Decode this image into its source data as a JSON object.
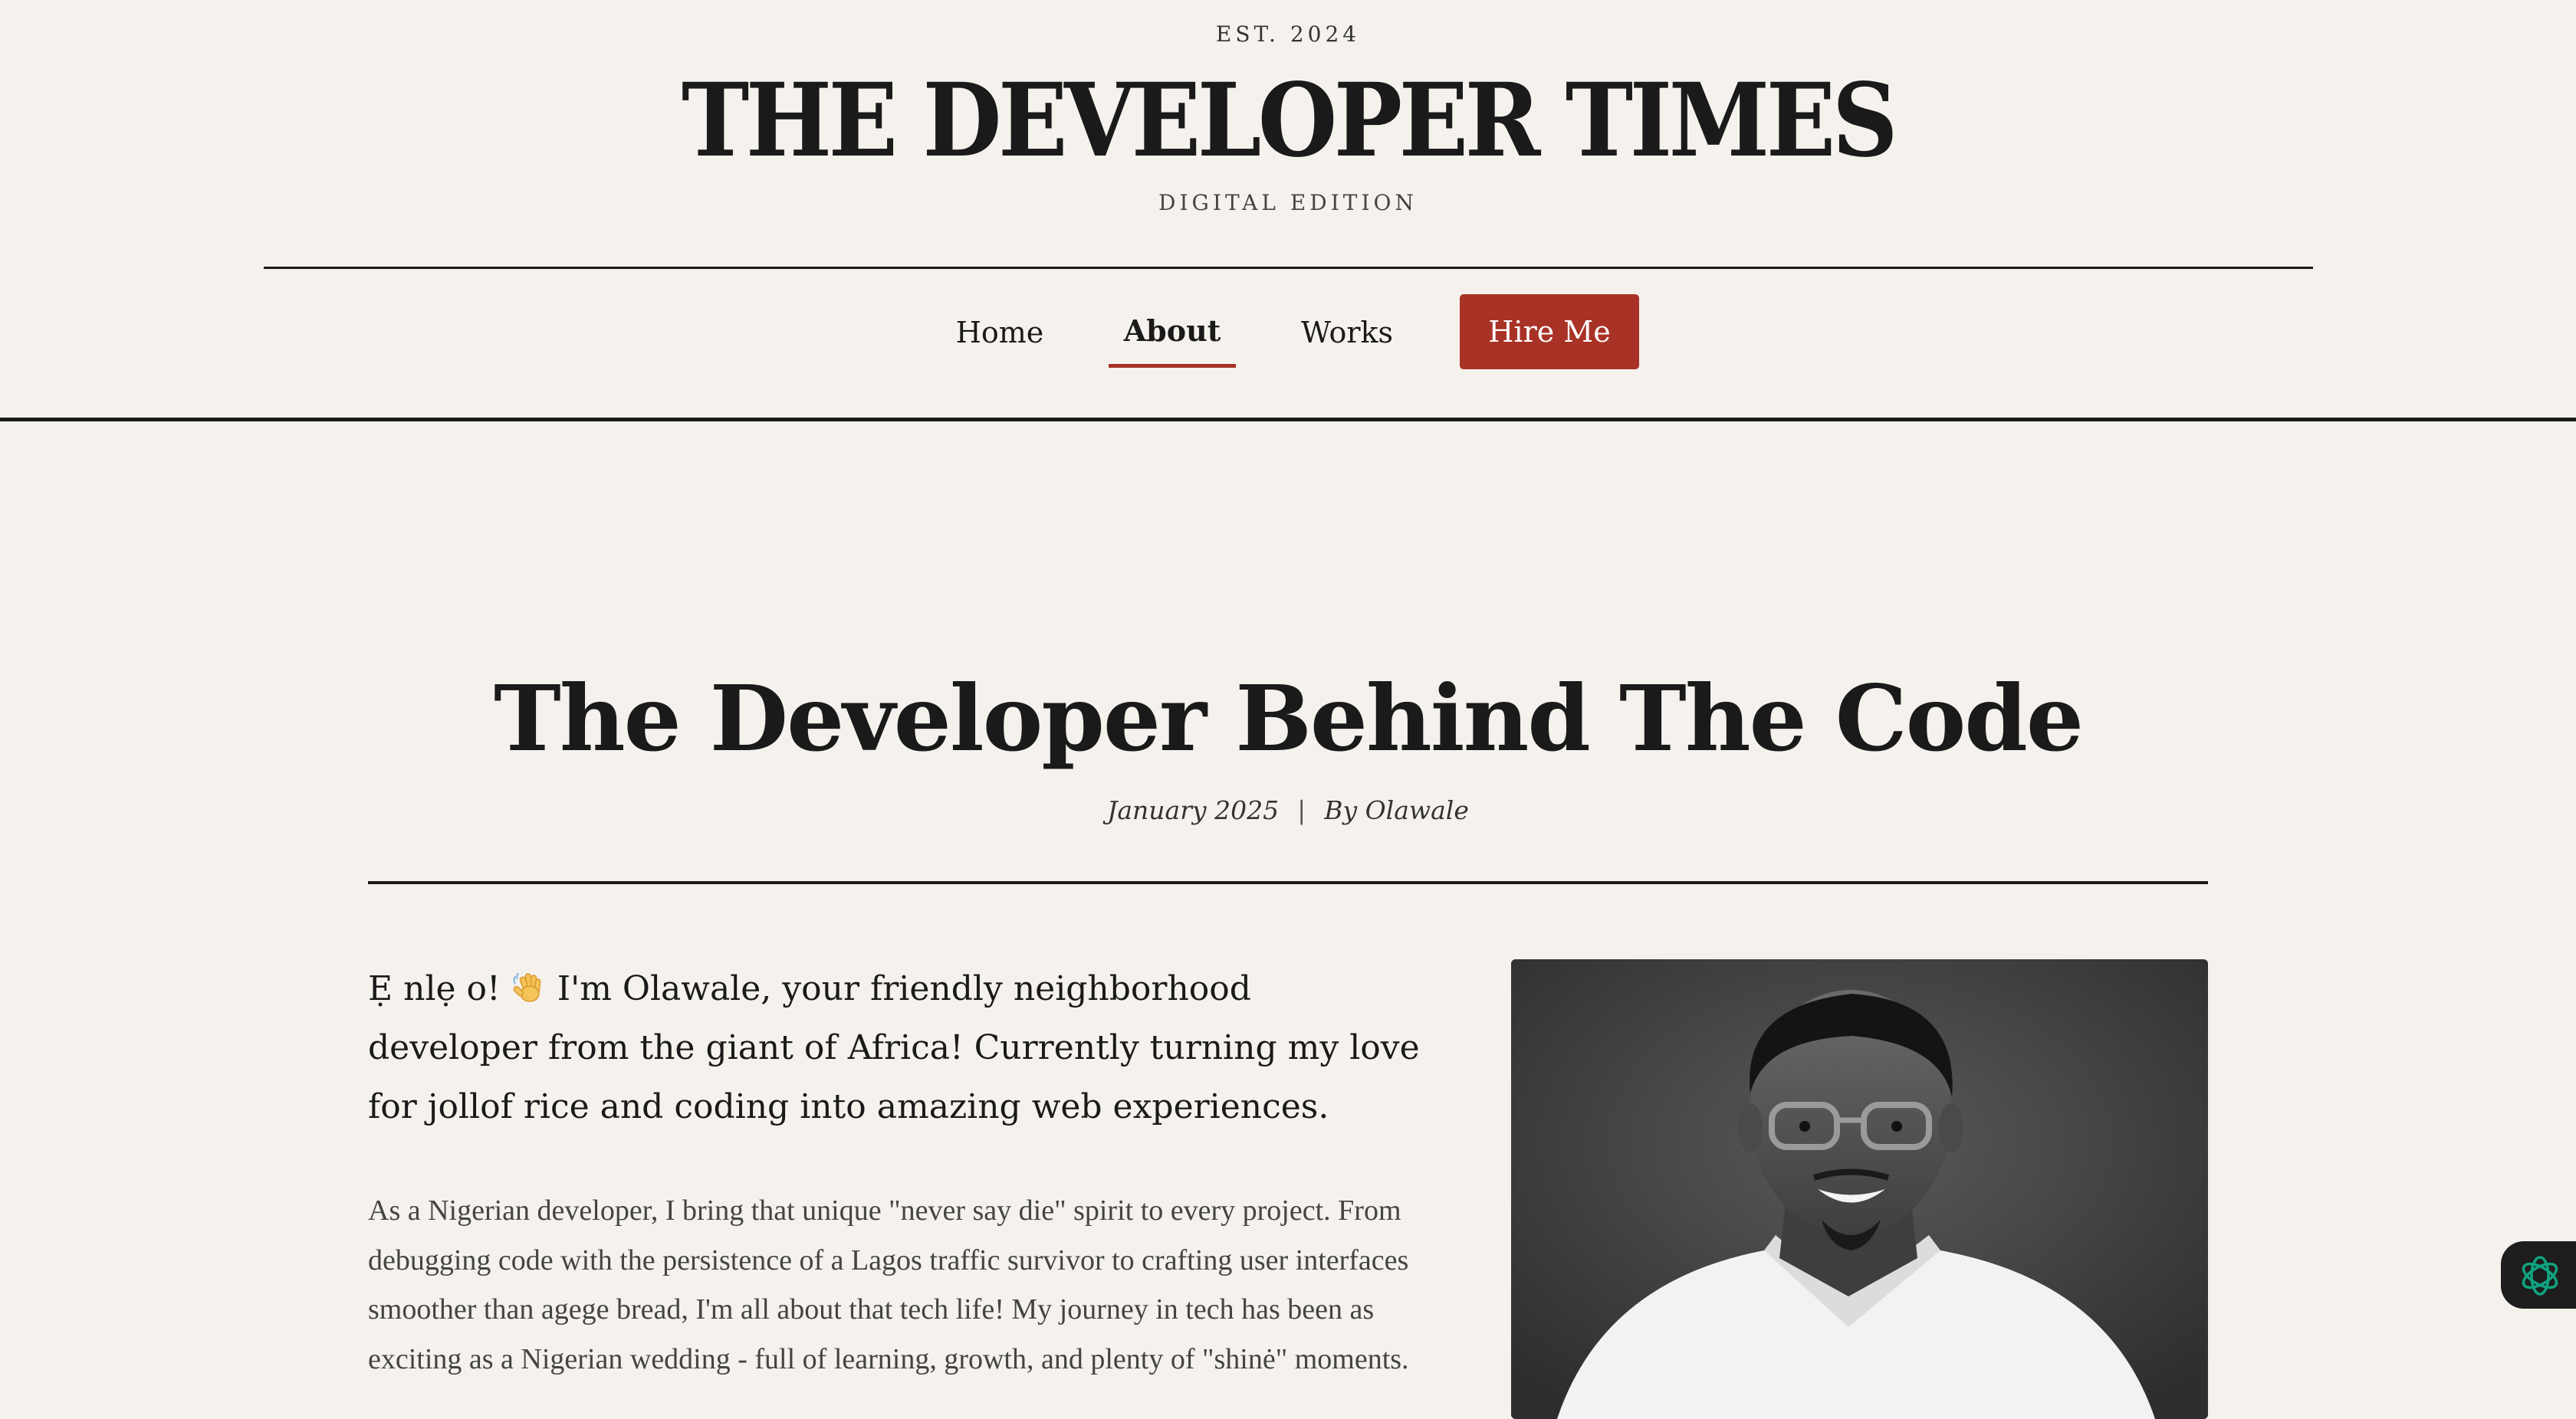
{
  "masthead": {
    "established": "EST. 2024",
    "title": "THE DEVELOPER TIMES",
    "edition": "DIGITAL EDITION"
  },
  "nav": {
    "items": [
      {
        "label": "Home",
        "active": false
      },
      {
        "label": "About",
        "active": true
      },
      {
        "label": "Works",
        "active": false
      }
    ],
    "cta_label": "Hire Me"
  },
  "article": {
    "title": "The Developer Behind The Code",
    "date": "January 2025",
    "separator": "|",
    "author": "By Olawale",
    "lead_greeting": "Ẹ nlẹ o!",
    "lead_text": " I'm Olawale, your friendly neighborhood developer from the giant of Africa! Currently turning my love for jollof rice and coding into amazing web experiences.",
    "body": "As a Nigerian developer, I bring that unique \"never say die\" spirit to every project. From debugging code with the persistence of a Lagos traffic survivor to crafting user interfaces smoother than agege bread, I'm all about that tech life! My journey in tech has been as exciting as a Nigerian wedding - full of learning, growth, and plenty of \"shinė\" moments."
  },
  "icons": {
    "wave": "waving-hand-icon",
    "assistant": "openai-assistant-icon"
  },
  "colors": {
    "background": "#f5f2ed",
    "accent": "#a93227",
    "text": "#1a1a1a"
  }
}
